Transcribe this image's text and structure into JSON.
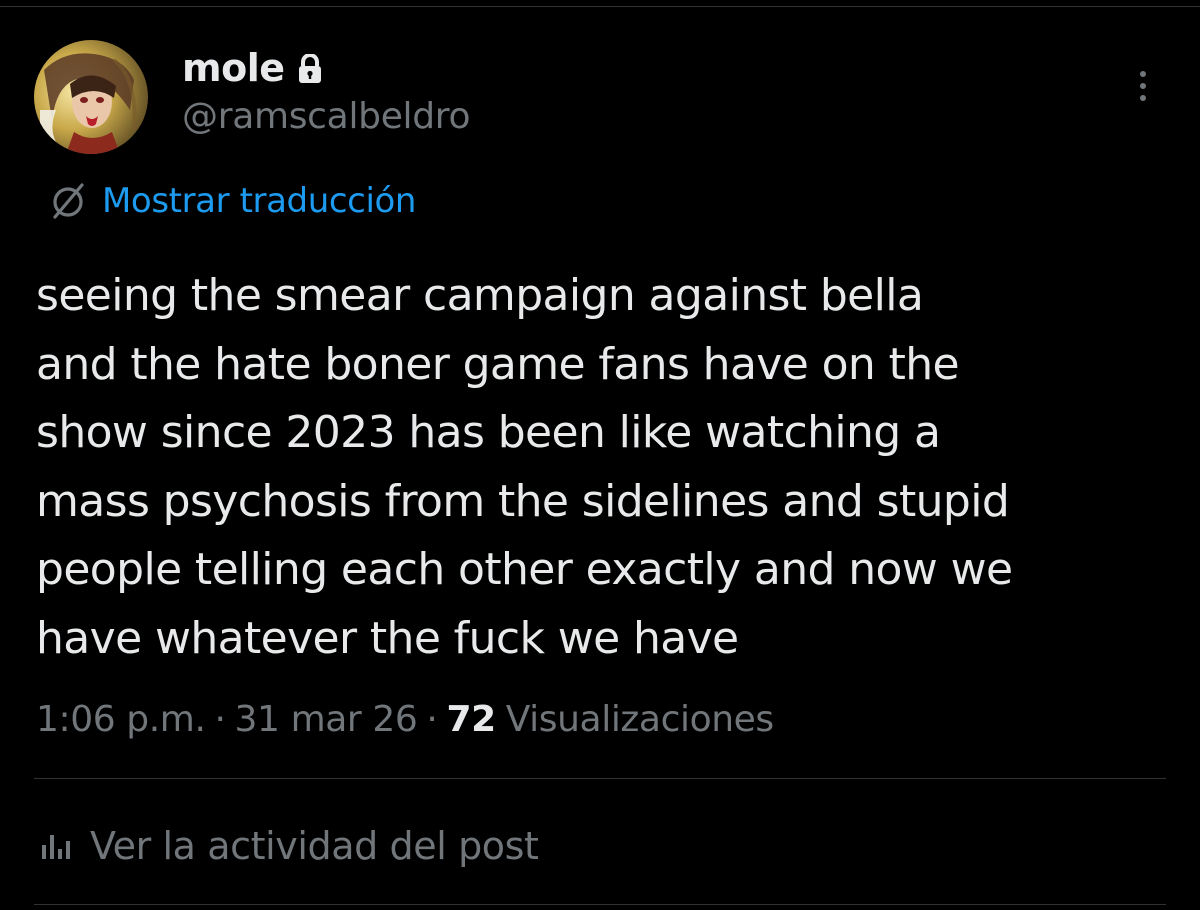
{
  "user": {
    "display_name": "mole",
    "handle": "@ramscalbeldro",
    "avatar_icon": "avatar-image",
    "protected_icon": "lock-icon"
  },
  "header": {
    "more_icon": "more-options-icon"
  },
  "translate": {
    "icon": "globe-strike-icon",
    "label": "Mostrar traducción"
  },
  "tweet": {
    "text": "seeing the smear campaign against bella\nand the hate boner game fans have on the\nshow since 2023 has been like watching a\nmass psychosis from the sidelines and stupid\npeople telling each other exactly and now we\nhave whatever the fuck we have"
  },
  "meta": {
    "time": "1:06 p.m.",
    "separator": "·",
    "date": "31 mar 26",
    "views_count": "72",
    "views_label": "Visualizaciones"
  },
  "activity": {
    "icon": "analytics-icon",
    "label": "Ver la actividad del post"
  },
  "colors": {
    "background": "#000000",
    "text": "#e7e9ea",
    "secondary": "#71767b",
    "accent": "#1d9bf0",
    "divider": "#2f3336"
  }
}
